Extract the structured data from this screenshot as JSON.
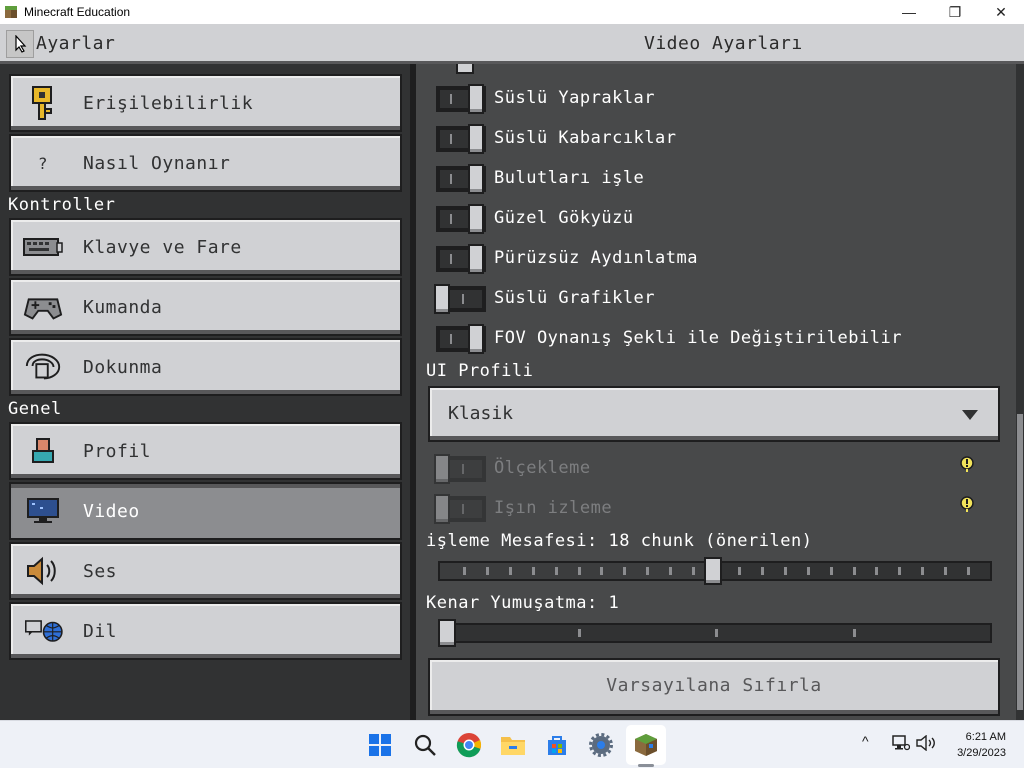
{
  "window": {
    "title": "Minecraft Education",
    "minimize_glyph": "—",
    "maximize_glyph": "❐",
    "close_glyph": "✕"
  },
  "header": {
    "left_title": "Ayarlar",
    "right_title": "Video Ayarları"
  },
  "sidebar": {
    "items_top": [
      {
        "label": "Erişilebilirlik",
        "icon": "key-icon"
      },
      {
        "label": "Nasıl Oynanır",
        "icon": "question-icon",
        "glyph": "?"
      }
    ],
    "section_controls": "Kontroller",
    "items_controls": [
      {
        "label": "Klavye ve Fare",
        "icon": "keyboard-icon"
      },
      {
        "label": "Kumanda",
        "icon": "gamepad-icon"
      },
      {
        "label": "Dokunma",
        "icon": "touch-icon"
      }
    ],
    "section_general": "Genel",
    "items_general": [
      {
        "label": "Profil",
        "icon": "profile-icon"
      },
      {
        "label": "Video",
        "icon": "monitor-icon",
        "selected": true
      },
      {
        "label": "Ses",
        "icon": "speaker-icon"
      },
      {
        "label": "Dil",
        "icon": "globe-icon"
      }
    ]
  },
  "video": {
    "toggles": [
      {
        "label": "Süslü Yapraklar",
        "on": true
      },
      {
        "label": "Süslü Kabarcıklar",
        "on": true
      },
      {
        "label": "Bulutları işle",
        "on": true
      },
      {
        "label": "Güzel Gökyüzü",
        "on": true
      },
      {
        "label": "Pürüzsüz Aydınlatma",
        "on": true
      },
      {
        "label": "Süslü Grafikler",
        "on": false
      },
      {
        "label": "FOV Oynanış Şekli ile Değiştirilebilir",
        "on": true
      }
    ],
    "ui_profile_label": "UI Profili",
    "ui_profile_value": "Klasik",
    "disabled_toggles": [
      {
        "label": "Ölçekleme",
        "on": false
      },
      {
        "label": "Işın izleme",
        "on": false
      }
    ],
    "render_distance_label": "işleme Mesafesi: 18 chunk (önerilen)",
    "render_distance_fraction": 0.5,
    "antialias_label": "Kenar Yumuşatma: 1",
    "antialias_fraction": 0.0,
    "reset_label": "Varsayılana Sıfırla"
  },
  "taskbar": {
    "icons": [
      "windows-start-icon",
      "search-icon",
      "chrome-icon",
      "file-explorer-icon",
      "store-icon",
      "settings-icon",
      "minecraft-icon"
    ],
    "clock_time": "6:21 AM",
    "clock_date": "3/29/2023",
    "tray_chevron": "^"
  },
  "colors": {
    "panel_dark": "#313233",
    "panel_mid": "#48494a",
    "button_light": "#d0d1d4",
    "button_selected": "#8c8d90"
  }
}
